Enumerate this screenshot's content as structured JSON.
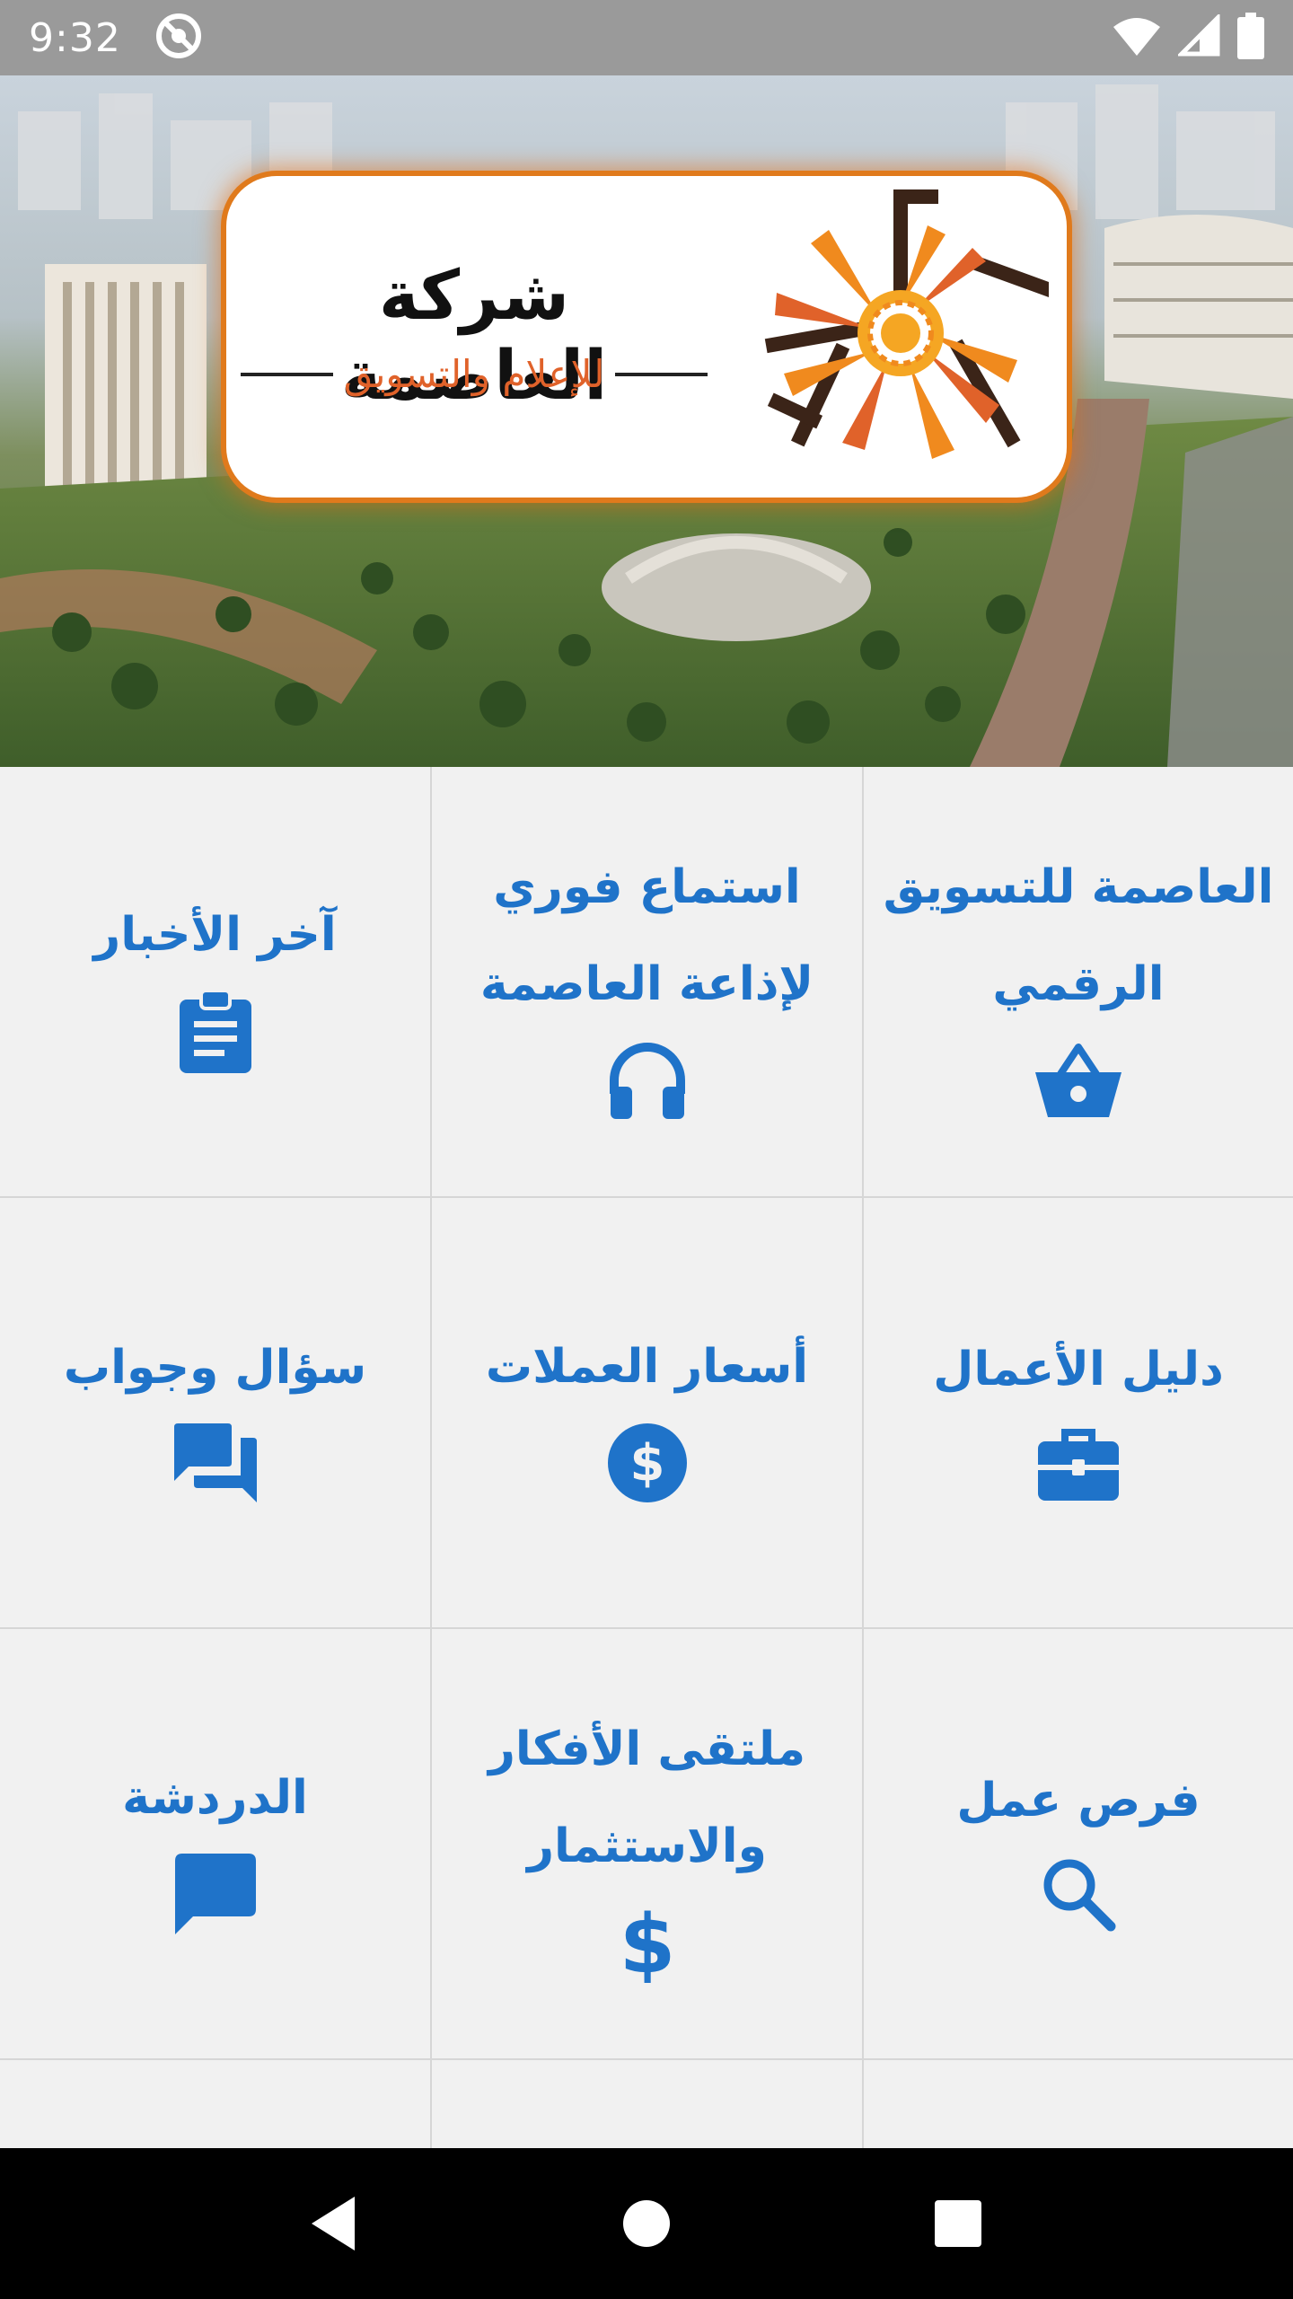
{
  "status_bar": {
    "time": "9:32"
  },
  "hero": {
    "logo_title": "شركة العاصمة",
    "logo_subtitle": "للإعلام والتسويق",
    "logo_accent_color": "#e0622a"
  },
  "grid": {
    "items": [
      {
        "label": "العاصمة للتسويق الرقمي",
        "icon": "basket-icon"
      },
      {
        "label": "استماع فوري لإذاعة العاصمة",
        "icon": "headphones-icon"
      },
      {
        "label": "آخر الأخبار",
        "icon": "clipboard-icon"
      },
      {
        "label": "دليل الأعمال",
        "icon": "briefcase-icon"
      },
      {
        "label": "أسعار العملات",
        "icon": "dollar-circle-icon"
      },
      {
        "label": "سؤال وجواب",
        "icon": "forum-icon"
      },
      {
        "label": "فرص عمل",
        "icon": "search-icon"
      },
      {
        "label": "ملتقى الأفكار والاستثمار",
        "icon": "dollar-icon"
      },
      {
        "label": "الدردشة",
        "icon": "chat-icon"
      }
    ],
    "accent_color": "#1f73c9"
  }
}
